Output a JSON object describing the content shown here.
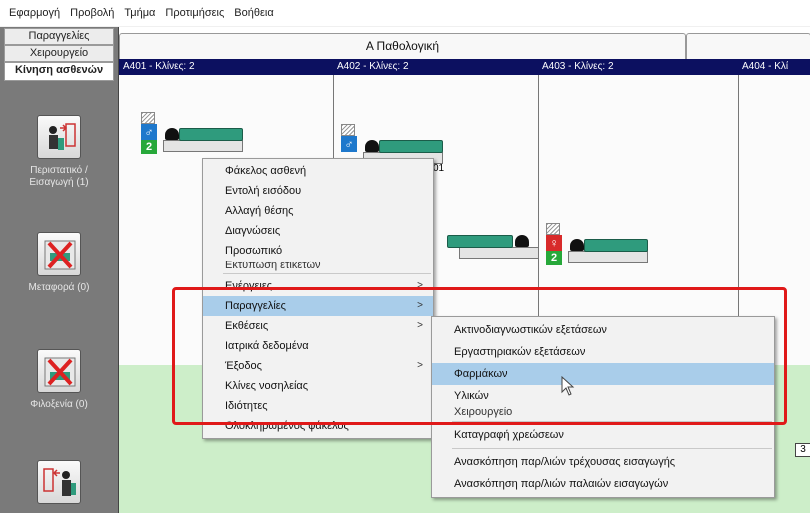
{
  "menubar": {
    "items": [
      "Εφαρμογή",
      "Προβολή",
      "Τμήμα",
      "Προτιμήσεις",
      "Βοήθεια"
    ]
  },
  "nav": {
    "tabs": [
      "Παραγγελίες",
      "Χειρουργείο",
      "Κίνηση ασθενών"
    ],
    "active_tab": "Κίνηση ασθενών",
    "buttons": [
      {
        "label": "Περιστατικό / Εισαγωγή (1)",
        "icon": "patient-admission-icon"
      },
      {
        "label": "Μεταφορά (0)",
        "icon": "patient-transfer-disabled-icon"
      },
      {
        "label": "Φιλοξενία (0)",
        "icon": "hosting-disabled-icon"
      },
      {
        "label": "",
        "icon": "patient-exit-icon"
      }
    ]
  },
  "department": {
    "title": "Α Παθολογική"
  },
  "rooms": [
    {
      "label": "A401 - Κλίνες: 2"
    },
    {
      "label": "A402 - Κλίνες: 2"
    },
    {
      "label": "A403 - Κλίνες: 2"
    },
    {
      "label": "A404 - Κλί"
    }
  ],
  "beds": [
    {
      "number": "2",
      "gender": "male"
    },
    {
      "number": "",
      "gender": "male"
    },
    {
      "number": "2",
      "gender": "female"
    },
    {
      "number": "3",
      "gender": ""
    }
  ],
  "bed_snippet_text": "01",
  "context_menu": {
    "items": [
      {
        "label": "Φάκελος ασθενή",
        "submenu": false
      },
      {
        "label": "Εντολή εισόδου",
        "submenu": false
      },
      {
        "label": "Αλλαγή θέσης",
        "submenu": false
      },
      {
        "label": "Διαγνώσεις",
        "submenu": false
      },
      {
        "label": "Προσωπικό",
        "submenu": false
      },
      {
        "label": "Εκτύπωση ετικετών",
        "submenu": false
      },
      {
        "label": "Ενέργειες",
        "submenu": true
      },
      {
        "label": "Παραγγελίες",
        "submenu": true,
        "highlighted": true
      },
      {
        "label": "Εκθέσεις",
        "submenu": true
      },
      {
        "label": "Ιατρικά δεδομένα",
        "submenu": false
      },
      {
        "label": "Έξοδος",
        "submenu": true
      },
      {
        "label": "Κλίνες νοσηλείας",
        "submenu": false
      },
      {
        "label": "Ιδιότητες",
        "submenu": false
      },
      {
        "label": "Ολοκληρωμένος φάκελος",
        "submenu": false
      }
    ]
  },
  "submenu": {
    "items": [
      {
        "label": "Ακτινοδιαγνωστικών εξετάσεων"
      },
      {
        "label": "Εργαστηριακών εξετάσεων"
      },
      {
        "label": "Φαρμάκων",
        "highlighted": true
      },
      {
        "label": "Υλικών"
      },
      {
        "label": "Χειρουργείο"
      },
      {
        "label": "Καταγραφή χρεώσεων"
      },
      {
        "label": "Ανασκόπηση παρ/λιών τρέχουσας εισαγωγής"
      },
      {
        "label": "Ανασκόπηση παρ/λιών παλαιών εισαγωγών"
      }
    ]
  },
  "colors": {
    "room_header": "#0c1060",
    "highlight": "#a9cdea",
    "annotation": "#e01919",
    "band": "#cdeec9",
    "blanket": "#2f9b7d"
  }
}
